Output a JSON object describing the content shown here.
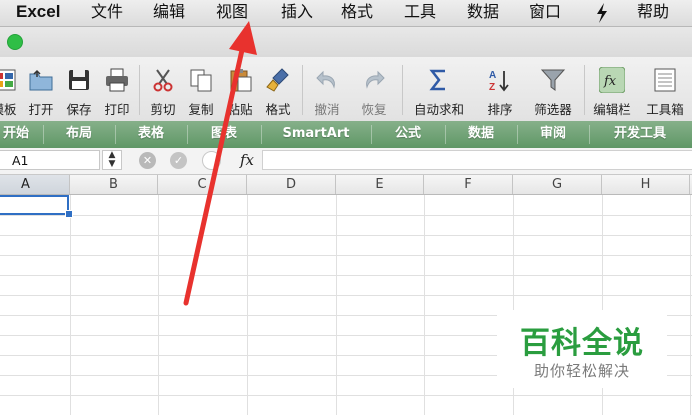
{
  "menubar": {
    "app_name": "Excel",
    "items": [
      "文件",
      "编辑",
      "视图",
      "插入",
      "格式",
      "工具",
      "数据",
      "窗口",
      "帮助"
    ]
  },
  "toolbar": {
    "items": [
      {
        "label": "模板",
        "icon": "template-icon"
      },
      {
        "label": "打开",
        "icon": "open-folder-icon"
      },
      {
        "label": "保存",
        "icon": "save-icon"
      },
      {
        "label": "打印",
        "icon": "print-icon"
      },
      {
        "label": "剪切",
        "icon": "scissors-icon"
      },
      {
        "label": "复制",
        "icon": "copy-icon"
      },
      {
        "label": "粘贴",
        "icon": "paste-icon"
      },
      {
        "label": "格式",
        "icon": "format-brush-icon"
      },
      {
        "label": "撤消",
        "icon": "undo-icon"
      },
      {
        "label": "恢复",
        "icon": "redo-icon"
      },
      {
        "label": "自动求和",
        "icon": "sigma-icon"
      },
      {
        "label": "排序",
        "icon": "sort-icon"
      },
      {
        "label": "筛选器",
        "icon": "filter-icon"
      },
      {
        "label": "编辑栏",
        "icon": "fx-icon"
      },
      {
        "label": "工具箱",
        "icon": "toolbox-icon"
      }
    ]
  },
  "ribbon": {
    "tabs": [
      "开始",
      "布局",
      "表格",
      "图表",
      "SmartArt",
      "公式",
      "数据",
      "审阅",
      "开发工具"
    ]
  },
  "formula_bar": {
    "name_box": "A1",
    "fx_label": "fx",
    "formula_value": ""
  },
  "grid": {
    "columns": [
      "A",
      "B",
      "C",
      "D",
      "E",
      "F",
      "G",
      "H"
    ],
    "selected_cell": "A1"
  },
  "watermark": {
    "title": "百科全说",
    "subtitle": "助你轻松解决"
  },
  "colors": {
    "ribbon": "#6fa275",
    "selection": "#2f6fc4",
    "annotation_arrow": "#e8322e",
    "watermark_green": "#2a9d3f"
  }
}
